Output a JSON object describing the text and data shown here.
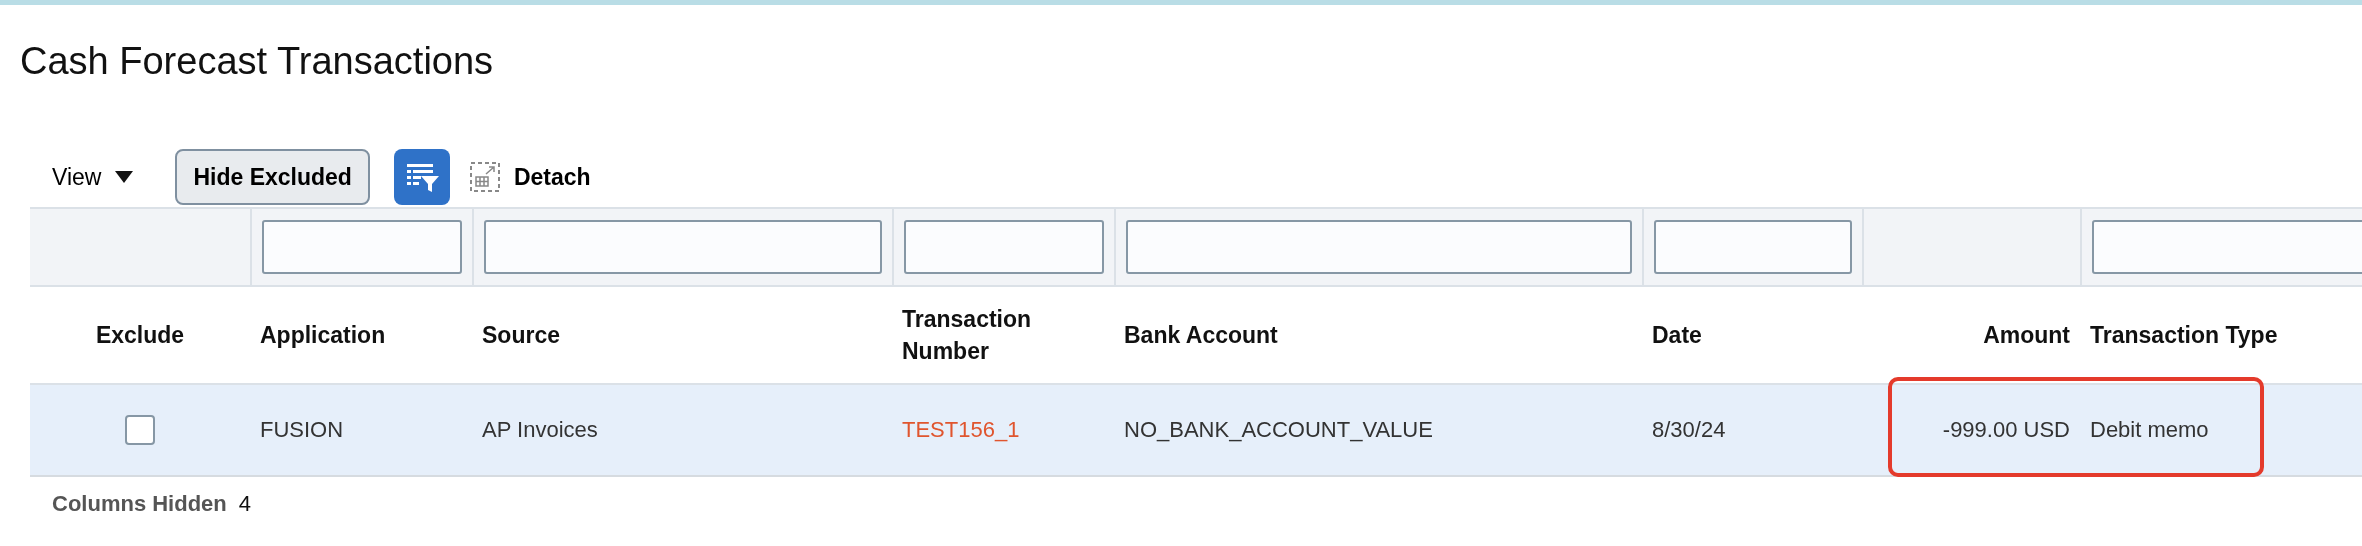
{
  "page": {
    "title": "Cash Forecast Transactions"
  },
  "toolbar": {
    "view_menu": "View",
    "hide_button": "Hide Excluded",
    "detach": "Detach"
  },
  "table": {
    "columns": [
      {
        "label": "Exclude",
        "filter": false
      },
      {
        "label": "Application",
        "filter": true
      },
      {
        "label": "Source",
        "filter": true
      },
      {
        "label": "Transaction Number",
        "filter": true
      },
      {
        "label": "Bank Account",
        "filter": true
      },
      {
        "label": "Date",
        "filter": true
      },
      {
        "label": "Amount",
        "filter": false
      },
      {
        "label": "Transaction Type",
        "filter": true
      }
    ],
    "rows": [
      {
        "selected": true,
        "cells": [
          {
            "kind": "checkbox",
            "checked": false
          },
          {
            "kind": "text",
            "text": "FUSION"
          },
          {
            "kind": "text",
            "text": "AP Invoices"
          },
          {
            "kind": "link",
            "text": "TEST156_1"
          },
          {
            "kind": "text",
            "text": "NO_BANK_ACCOUNT_VALUE"
          },
          {
            "kind": "text",
            "text": "8/30/24"
          },
          {
            "kind": "text",
            "text": "-999.00 USD"
          },
          {
            "kind": "text",
            "text": "Debit memo"
          }
        ]
      }
    ]
  },
  "footer": {
    "label": "Columns Hidden",
    "count": "4"
  }
}
